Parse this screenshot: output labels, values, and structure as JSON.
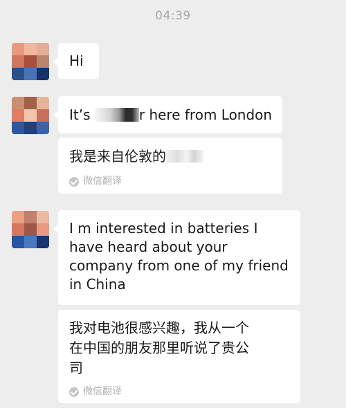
{
  "timestamp": "04:39",
  "messages": [
    {
      "text": "Hi"
    },
    {
      "text_before": "It’s ",
      "text_after": "r here from London"
    },
    {
      "text": "I m interested in batteries I\nhave heard about your\ncompany from one of my friend\n in China"
    }
  ],
  "translations": [
    {
      "text": "我是来自伦敦的",
      "label": "微信翻译"
    },
    {
      "text": "我对电池很感兴趣，我从一个\n在中国的朋友那里听说了贵公\n司",
      "label": "微信翻译"
    }
  ],
  "icons": {
    "translate_check": "check-circle-icon",
    "avatar": "pixelated-avatar"
  }
}
